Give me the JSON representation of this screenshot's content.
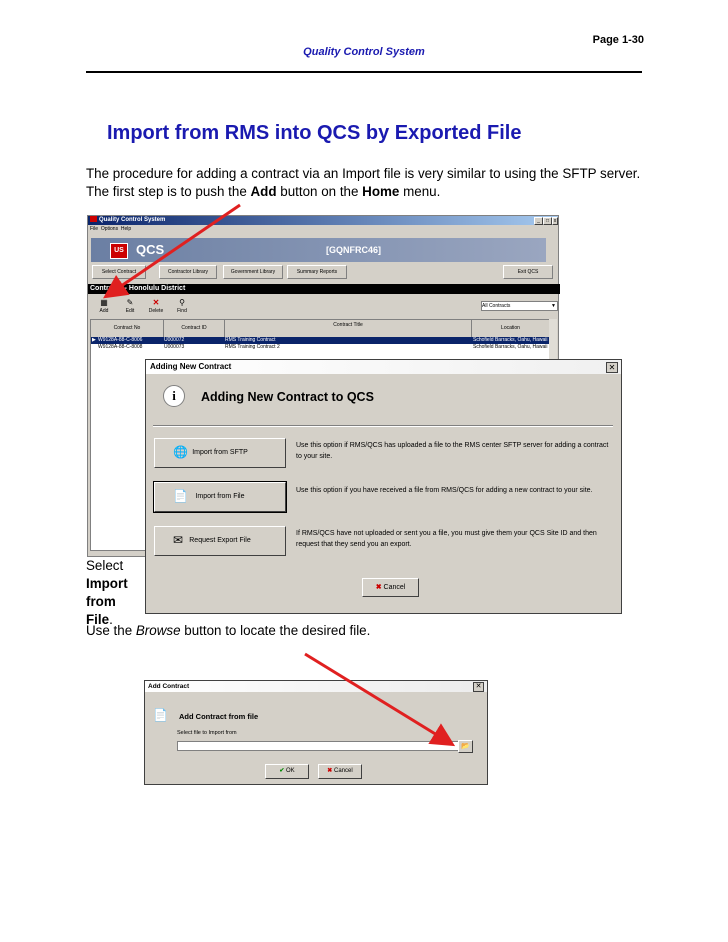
{
  "page": {
    "number": "Page  1-30",
    "header": "Quality Control System"
  },
  "heading": "Import from RMS into QCS by Exported File",
  "intro": {
    "part1": "The procedure for adding a contract via an Import file is very similar to using the SFTP server. The first step is to push the ",
    "add": "Add",
    "part2": " button on the ",
    "home": "Home",
    "part3": " menu."
  },
  "main_window": {
    "title": "Quality Control System",
    "menu": [
      "File",
      "Options",
      "Help"
    ],
    "controls": [
      "_",
      "□",
      "x"
    ],
    "logo": "US",
    "banner_title": "QCS",
    "banner_code": "[GQNFRC46]",
    "nav": [
      "Select Contract",
      "Contractor Library",
      "Government Library",
      "Summary Reports",
      "Exit QCS"
    ],
    "district": "Contracts - Honolulu District",
    "toolbar": [
      {
        "label": "Add",
        "icon": "add-icon"
      },
      {
        "label": "Edit",
        "icon": "edit-icon"
      },
      {
        "label": "Delete",
        "icon": "delete-icon"
      },
      {
        "label": "Find",
        "icon": "find-icon"
      }
    ],
    "filter": "All Contracts",
    "columns": [
      "Contract No",
      "Contract ID",
      "Contract Title",
      "Location"
    ],
    "rows": [
      {
        "no": "W9128A-88-C-8006",
        "id": "U000072",
        "title": "RMS Training Contract",
        "location": "Schofield Barracks, Oahu, Hawaii"
      },
      {
        "no": "W9128A-88-C-8008",
        "id": "U000073",
        "title": "RMS Training Contract 2",
        "location": "Schofield Barracks, Oahu, Hawaii"
      }
    ]
  },
  "dialog": {
    "title": "Adding New Contract",
    "heading": "Adding New Contract to QCS",
    "options": [
      {
        "label": "Import from SFTP",
        "desc": "Use this option if RMS/QCS has uploaded a file to the RMS center SFTP server for adding a contract to your site."
      },
      {
        "label": "Import from File",
        "desc": "Use this option if you have received a file from RMS/QCS for adding a new contract to your site."
      },
      {
        "label": "Request Export File",
        "desc": "If RMS/QCS have not uploaded or sent you a file, you must give them your QCS Site ID and then request that they send you an export."
      }
    ],
    "cancel": "Cancel"
  },
  "select_text": {
    "part1": "Select ",
    "bold": "Import from File",
    "part2": "."
  },
  "browse_text": {
    "part1": "Use the ",
    "italic": "Browse",
    "part2": " button to locate the desired file."
  },
  "add_dialog": {
    "title": "Add Contract",
    "heading": "Add Contract from file",
    "label": "Select file to Import from",
    "ok": "OK",
    "cancel": "Cancel"
  },
  "colors": {
    "heading": "#1a1ab0",
    "arrow": "#e02020",
    "titlebar": "#0a246a"
  }
}
